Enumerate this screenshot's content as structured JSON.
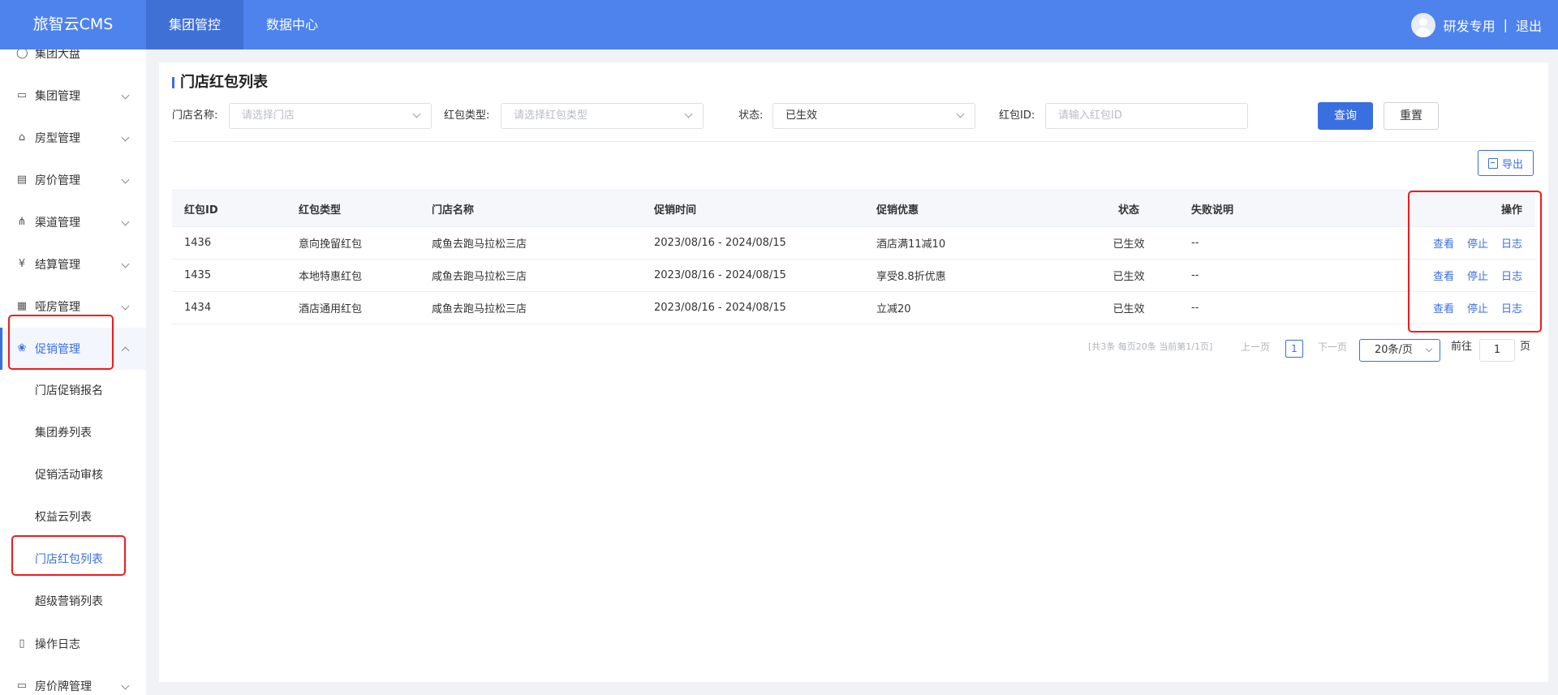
{
  "header": {
    "brand": "旅智云CMS",
    "tabs": [
      {
        "label": "集团管控"
      },
      {
        "label": "数据中心"
      }
    ],
    "user_name": "研发专用",
    "separator": "|",
    "logout": "退出"
  },
  "sidebar": {
    "top_partial": "集团大盘",
    "menu": [
      {
        "label": "集团管理",
        "icon": "chart-icon"
      },
      {
        "label": "房型管理",
        "icon": "home-icon"
      },
      {
        "label": "房价管理",
        "icon": "card-icon"
      },
      {
        "label": "渠道管理",
        "icon": "network-icon"
      },
      {
        "label": "结算管理",
        "icon": "yen-icon"
      },
      {
        "label": "哑房管理",
        "icon": "document-icon"
      },
      {
        "label": "促销管理",
        "icon": "promotion-icon"
      }
    ],
    "submenu": [
      {
        "label": "门店促销报名"
      },
      {
        "label": "集团券列表"
      },
      {
        "label": "促销活动审核"
      },
      {
        "label": "权益云列表"
      },
      {
        "label": "门店红包列表"
      },
      {
        "label": "超级营销列表"
      }
    ],
    "tail_menu": [
      {
        "label": "操作日志",
        "icon": "log-icon"
      },
      {
        "label": "房价牌管理",
        "icon": "board-icon"
      }
    ]
  },
  "page": {
    "title": "门店红包列表",
    "filters": {
      "store_label": "门店名称:",
      "store_placeholder": "请选择门店",
      "type_label": "红包类型:",
      "type_placeholder": "请选择红包类型",
      "status_label": "状态:",
      "status_value": "已生效",
      "id_label": "红包ID:",
      "id_placeholder": "请输入红包ID"
    },
    "query_button": "查询",
    "reset_button": "重置",
    "export_button": "导出"
  },
  "table": {
    "columns": [
      "红包ID",
      "红包类型",
      "门店名称",
      "促销时间",
      "促销优惠",
      "状态",
      "失败说明",
      "操作"
    ],
    "rows": [
      {
        "id": "1436",
        "type": "意向挽留红包",
        "store": "咸鱼去跑马拉松三店",
        "time": "2023/08/16 - 2024/08/15",
        "offer": "酒店满11减10",
        "status": "已生效",
        "fail": "--"
      },
      {
        "id": "1435",
        "type": "本地特惠红包",
        "store": "咸鱼去跑马拉松三店",
        "time": "2023/08/16 - 2024/08/15",
        "offer": "享受8.8折优惠",
        "status": "已生效",
        "fail": "--"
      },
      {
        "id": "1434",
        "type": "酒店通用红包",
        "store": "咸鱼去跑马拉松三店",
        "time": "2023/08/16 - 2024/08/15",
        "offer": "立减20",
        "status": "已生效",
        "fail": "--"
      }
    ],
    "actions": {
      "view": "查看",
      "stop": "停止",
      "log": "日志"
    }
  },
  "pagination": {
    "info": "[共3条 每页20条 当前第1/1页]",
    "prev": "上一页",
    "current_page": "1",
    "next": "下一页",
    "page_size": "20条/页",
    "goto_label": "前往",
    "goto_value": "1",
    "goto_unit": "页"
  },
  "colors": {
    "header_bg": "#4e83ee",
    "accent": "#3a6fe0",
    "highlight_box": "#f21b1b"
  }
}
